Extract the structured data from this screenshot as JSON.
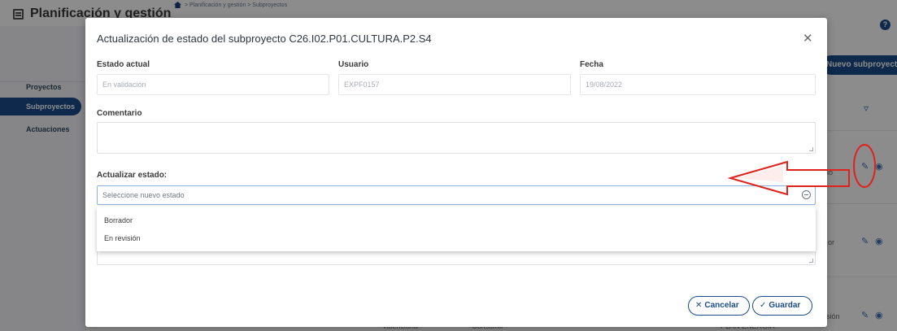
{
  "background": {
    "app_title": "Planificación y gestión",
    "breadcrumb": "> Planificación y gestión > Subproyectos",
    "help_icon": "question-circle-icon",
    "sidebar": {
      "items": [
        {
          "label": "Proyectos",
          "active": false
        },
        {
          "label": "Subproyectos",
          "active": true
        },
        {
          "label": "Actuaciones",
          "active": false
        }
      ]
    },
    "new_button_label": "Nuevo subproyecto",
    "row_texts": [
      "lo",
      "or",
      "sión"
    ],
    "bottom_texts": [
      "Valenciana",
      "Consumo",
      "PLAN ENERGIA"
    ]
  },
  "modal": {
    "title": "Actualización de estado del subproyecto C26.I02.P01.CULTURA.P2.S4",
    "close_icon": "close-icon",
    "fields": {
      "estado_actual": {
        "label": "Estado actual",
        "value": "En validación"
      },
      "usuario": {
        "label": "Usuario",
        "value": "EXPF0157"
      },
      "fecha": {
        "label": "Fecha",
        "value": "19/08/2022"
      }
    },
    "comentario_label": "Comentario",
    "actualizar_label": "Actualizar estado:",
    "select": {
      "placeholder": "Seleccione nuevo estado",
      "options": [
        "Borrador",
        "En revisión"
      ]
    },
    "cancel_label": "Cancelar",
    "save_label": "Guardar"
  },
  "colors": {
    "primary": "#1b4b8a",
    "annotation": "#e0221c"
  }
}
